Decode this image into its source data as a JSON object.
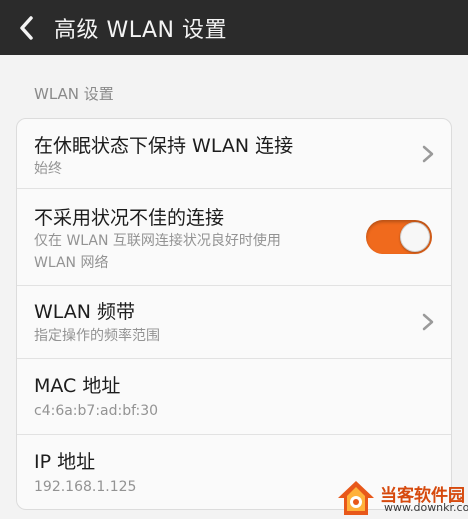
{
  "header": {
    "title": "高级 WLAN 设置"
  },
  "section": {
    "label": "WLAN 设置"
  },
  "settings": {
    "sleep_keep": {
      "title": "在休眠状态下保持 WLAN 连接",
      "value": "始终"
    },
    "avoid_poor": {
      "title": "不采用状况不佳的连接",
      "description_line1": "仅在 WLAN 互联网连接状况良好时使用",
      "description_line2": "WLAN 网络",
      "enabled": true
    },
    "band": {
      "title": "WLAN 频带",
      "description": "指定操作的频率范围"
    },
    "mac": {
      "title": "MAC 地址",
      "value": "c4:6a:b7:ad:bf:30"
    },
    "ip": {
      "title": "IP 地址",
      "value": "192.168.1.125"
    }
  },
  "colors": {
    "toggle_on": "#f06a1d",
    "topbar": "#2b2b2b",
    "watermark": "#d64a0e"
  },
  "watermark": {
    "name": "当客软件园",
    "url": "www.downkr.com"
  }
}
